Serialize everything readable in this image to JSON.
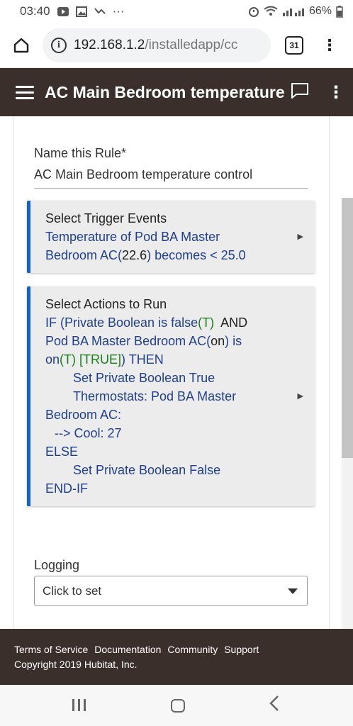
{
  "status_bar": {
    "time": "03:40",
    "dots": "···",
    "battery": "66%"
  },
  "browser": {
    "url_host": "192.168.1.2",
    "url_path": "/installedapp/cc",
    "tab_count": "31",
    "more": "⋮"
  },
  "app_header": {
    "title": "AC Main Bedroom temperature",
    "more": "⋮"
  },
  "rule": {
    "name_label": "Name this Rule*",
    "name_value": "AC Main Bedroom temperature control"
  },
  "trigger": {
    "title": "Select Trigger Events",
    "line1": "Temperature of Pod BA Master",
    "line2_pre": "Bedroom AC(",
    "line2_val": "22.6",
    "line2_post": ") becomes < 25.0"
  },
  "actions": {
    "title": "Select Actions to Run",
    "l1_pre": "IF (Private Boolean is false",
    "l1_t": "(T)",
    "l1_and": "AND",
    "l2_pre": "Pod BA Master Bedroom AC(",
    "l2_on": "on",
    "l2_post": ") is",
    "l3_pre": "on",
    "l3_t": "(T)",
    "l3_true": "[TRUE]",
    "l3_post": ") THEN",
    "l4": "Set Private Boolean True",
    "l5": "Thermostats: Pod BA Master",
    "l6": "Bedroom AC:",
    "l7": "--> Cool: 27",
    "l8": "ELSE",
    "l9": "Set Private Boolean False",
    "l10": "END-IF"
  },
  "logging": {
    "label": "Logging",
    "select_value": "Click to set"
  },
  "footer": {
    "links": [
      "Terms of Service",
      "Documentation",
      "Community",
      "Support"
    ],
    "copyright": "Copyright 2019 Hubitat, Inc."
  }
}
